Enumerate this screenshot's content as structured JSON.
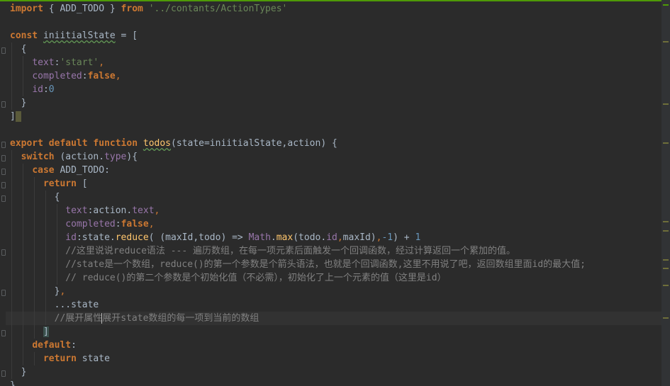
{
  "editor": {
    "theme_colors": {
      "background": "#2b2b2b",
      "keyword": "#cc7832",
      "string": "#6a8759",
      "property": "#9876aa",
      "number": "#6897bb",
      "function": "#ffc66d",
      "comment": "#808080",
      "text": "#a9b7c6"
    },
    "code": {
      "l1": {
        "kw_import": "import",
        "t1": " { ADD_TODO } ",
        "kw_from": "from",
        "sp": " ",
        "str": "'../contants/ActionTypes'"
      },
      "l3": {
        "kw_const": "const",
        "sp": " ",
        "name": "iniitialState",
        "t1": " = ["
      },
      "l4": {
        "t1": "{"
      },
      "l5": {
        "prop": "text",
        "colon": ":",
        "str": "'start'",
        "comma": ","
      },
      "l6": {
        "prop": "completed",
        "colon": ":",
        "kw_false": "false",
        "comma": ","
      },
      "l7": {
        "prop": "id",
        "colon": ":",
        "num": "0"
      },
      "l8": {
        "t1": "}"
      },
      "l9": {
        "t1": "]"
      },
      "l11": {
        "kw_export": "export",
        "kw_default": "default",
        "kw_function": "function",
        "fn_name": "todos",
        "t1": "(state=iniitialState,action) {"
      },
      "l12": {
        "kw_switch": "switch",
        "t1": " (action.",
        "prop": "type",
        "t2": "){"
      },
      "l13": {
        "kw_case": "case",
        "t1": " ADD_TODO:"
      },
      "l14": {
        "kw_return": "return",
        "t1": " ["
      },
      "l15": {
        "t1": "{"
      },
      "l16": {
        "prop": "text",
        "t1": ":action.",
        "prop2": "text",
        "comma": ","
      },
      "l17": {
        "prop": "completed",
        "colon": ":",
        "kw_false": "false",
        "comma": ","
      },
      "l18": {
        "prop": "id",
        "t1": ":state.",
        "fn": "reduce",
        "t2": "( (maxId,todo) => ",
        "obj": "Math",
        "dot": ".",
        "fn2": "max",
        "t3": "(todo.",
        "prop2": "id",
        "comma1": ",",
        "t4": "maxId)",
        "comma2": ",",
        "num1": "-1",
        "t5": ") + ",
        "num2": "1"
      },
      "l19": {
        "cmt": "//这里说说reduce语法 --- 遍历数组，在每一项元素后面触发一个回调函数，经过计算返回一个累加的值。"
      },
      "l20": {
        "cmt": "//state是一个数组，reduce()的第一个参数是个箭头语法，也就是个回调函数,这里不用说了吧，返回数组里面id的最大值;"
      },
      "l21": {
        "cmt": "// reduce()的第二个参数是个初始化值（不必需），初始化了上一个元素的值（这里是id）"
      },
      "l22": {
        "t1": "}",
        "comma": ","
      },
      "l23": {
        "t1": "...state"
      },
      "l24": {
        "cmt_a": "//展开属性",
        "cmt_b": "展开state数组的每一项到当前的数组"
      },
      "l25": {
        "t1": "]"
      },
      "l26": {
        "kw_default": "default",
        "t1": ":"
      },
      "l27": {
        "kw_return": "return",
        "t1": " state"
      },
      "l28": {
        "t1": "}"
      },
      "l29": {
        "t1": "}"
      }
    }
  }
}
